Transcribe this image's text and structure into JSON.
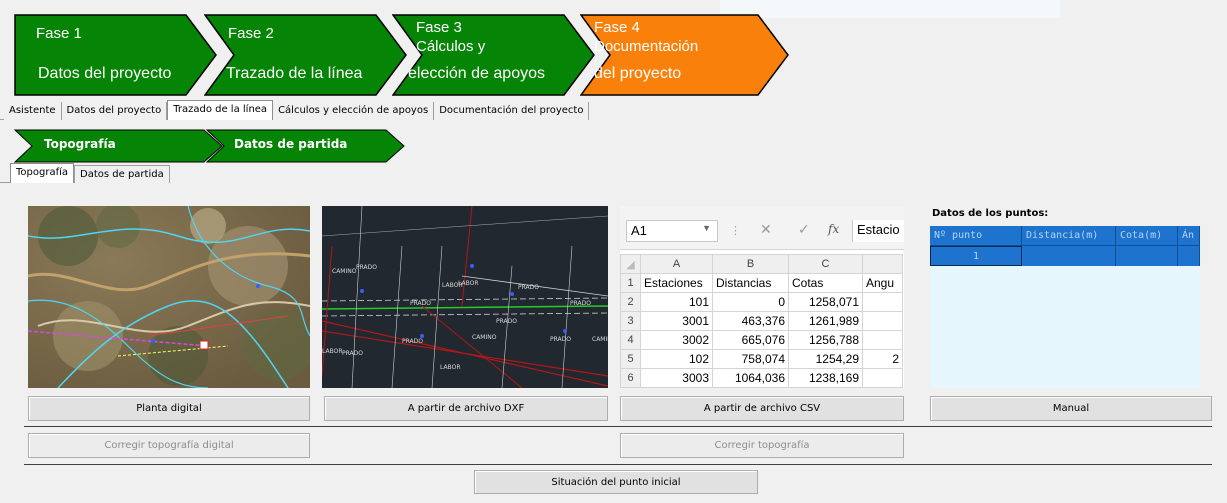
{
  "phases": [
    {
      "title": "Fase 1",
      "subtitle": "Datos del proyecto",
      "color": "#068406"
    },
    {
      "title": "Fase 2",
      "subtitle": "Trazado de la línea",
      "color": "#068406"
    },
    {
      "title": "Fase 3\n Cálculos y",
      "subtitle": "elección de apoyos",
      "color": "#068406"
    },
    {
      "title": "Fase 4\n Documentación",
      "subtitle": "del proyecto",
      "color": "#f9800a"
    }
  ],
  "main_tabs": [
    "Asistente",
    "Datos del proyecto",
    "Trazado de la línea",
    "Cálculos y elección de apoyos",
    "Documentación del proyecto"
  ],
  "sub_steps": [
    "Topografía",
    "Datos de partida"
  ],
  "sub_tabs": [
    "Topografía",
    "Datos de partida"
  ],
  "excel": {
    "cell_ref": "A1",
    "formula_value": "Estacio",
    "col_headers": [
      "A",
      "B",
      "C",
      ""
    ],
    "rows": [
      {
        "n": "1",
        "cells": [
          "Estaciones",
          "Distancias",
          "Cotas",
          "Angu"
        ]
      },
      {
        "n": "2",
        "cells": [
          "101",
          "0",
          "1258,071",
          ""
        ]
      },
      {
        "n": "3",
        "cells": [
          "3001",
          "463,376",
          "1261,989",
          ""
        ]
      },
      {
        "n": "4",
        "cells": [
          "3002",
          "665,076",
          "1256,788",
          ""
        ]
      },
      {
        "n": "5",
        "cells": [
          "102",
          "758,074",
          "1254,29",
          "2"
        ]
      },
      {
        "n": "6",
        "cells": [
          "3003",
          "1064,036",
          "1238,169",
          ""
        ]
      }
    ]
  },
  "cad_labels": [
    "PRADO",
    "LABOR",
    "PRADO",
    "PRADO",
    "PRADO",
    "PRADO",
    "PRADO",
    "PRADO",
    "LABOR",
    "PRADO",
    "CAMINO",
    "LABOR",
    "LABOR",
    "CAMINO",
    "CAMINO"
  ],
  "points_panel": {
    "title": "Datos de los puntos:",
    "headers": [
      "Nº punto",
      "Distancia(m)",
      "Cota(m)",
      "Án"
    ],
    "first_row": [
      "1",
      "",
      "",
      ""
    ]
  },
  "buttons": {
    "planta_digital": "Planta digital",
    "dxf": "A partir de archivo DXF",
    "csv": "A partir de archivo CSV",
    "manual": "Manual",
    "corregir_digital": "Corregir topografía digital",
    "corregir": "Corregir topografía",
    "situacion": "Situación del punto inicial"
  }
}
